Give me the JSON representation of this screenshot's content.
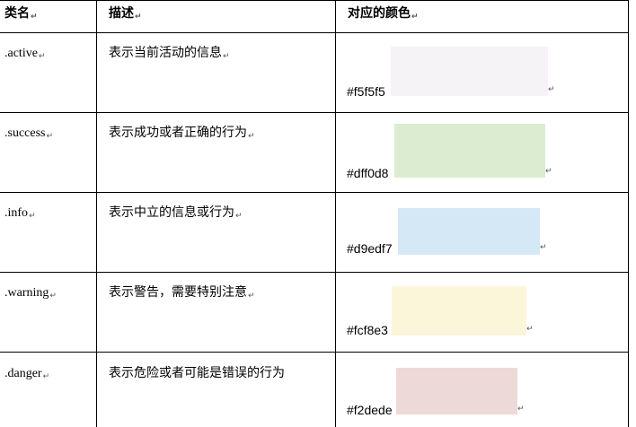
{
  "header": {
    "col1": "类名",
    "col2": "描述",
    "col3": "对应的颜色"
  },
  "paragraph_mark": "↵",
  "rows": [
    {
      "class_name": ".active",
      "description": "表示当前活动的信息",
      "hex": "#f5f5f5",
      "color": "#f5f3f5"
    },
    {
      "class_name": ".success",
      "description": "表示成功或者正确的行为",
      "hex": "#dff0d8",
      "color": "#dcecd0"
    },
    {
      "class_name": ".info",
      "description": "表示中立的信息或行为",
      "hex": "#d9edf7",
      "color": "#d5e8f6"
    },
    {
      "class_name": ".warning",
      "description": "表示警告，需要特别注意",
      "hex": "#fcf8e3",
      "color": "#fbf5d9"
    },
    {
      "class_name": ".danger",
      "description": "表示危险或者可能是错误的行为",
      "hex": "#f2dede",
      "color": "#eed9d9"
    }
  ]
}
